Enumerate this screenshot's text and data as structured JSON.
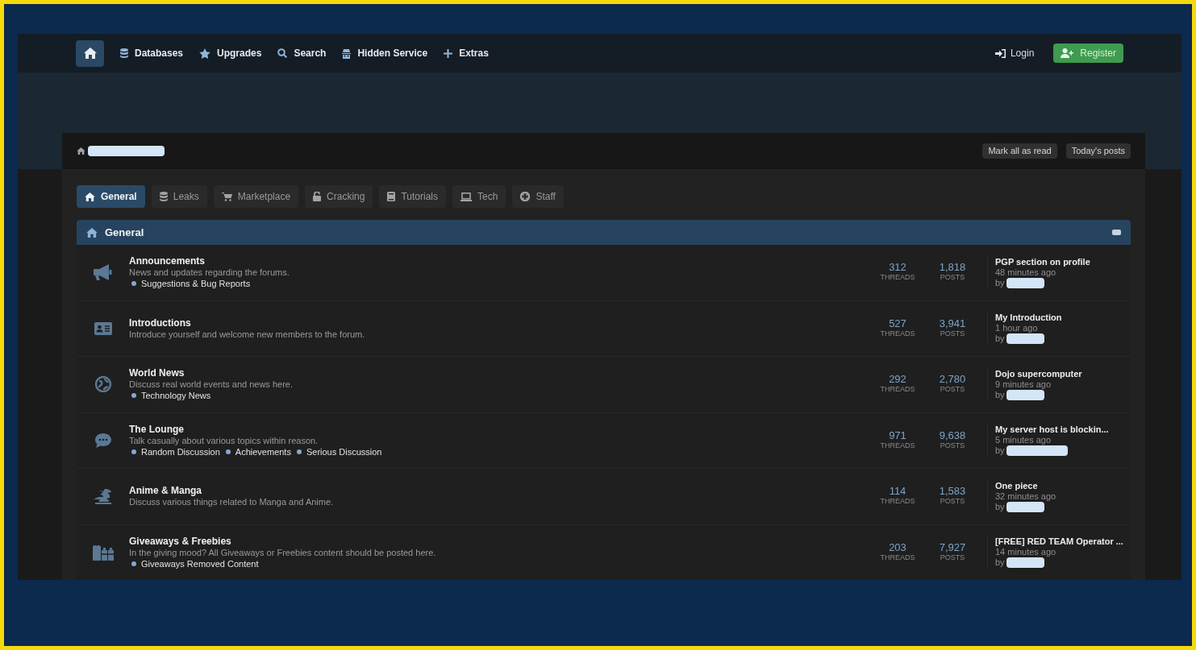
{
  "nav": {
    "items": [
      {
        "label": "Databases"
      },
      {
        "label": "Upgrades"
      },
      {
        "label": "Search"
      },
      {
        "label": "Hidden Service"
      },
      {
        "label": "Extras"
      }
    ],
    "login": "Login",
    "register": "Register"
  },
  "actions": [
    "Mark all as read",
    "Today's posts"
  ],
  "tabs": [
    {
      "label": "General",
      "selected": true
    },
    {
      "label": "Leaks",
      "selected": false
    },
    {
      "label": "Marketplace",
      "selected": false
    },
    {
      "label": "Cracking",
      "selected": false
    },
    {
      "label": "Tutorials",
      "selected": false
    },
    {
      "label": "Tech",
      "selected": false
    },
    {
      "label": "Staff",
      "selected": false
    }
  ],
  "section": {
    "title": "General"
  },
  "forums": [
    {
      "title": "Announcements",
      "description": "News and updates regarding the forums.",
      "subforums": [
        "Suggestions & Bug Reports"
      ],
      "threads": "312",
      "threads_label": "THREADS",
      "posts": "1,818",
      "posts_label": "POSTS",
      "last_post": {
        "title": "PGP section on profile",
        "time": "48 minutes ago",
        "by": "by"
      }
    },
    {
      "title": "Introductions",
      "description": "Introduce yourself and welcome new members to the forum.",
      "threads": "527",
      "threads_label": "THREADS",
      "posts": "3,941",
      "posts_label": "POSTS",
      "last_post": {
        "title": "My Introduction",
        "time": "1 hour ago",
        "by": "by"
      }
    },
    {
      "title": "World News",
      "description": "Discuss real world events and news here.",
      "subforums": [
        "Technology News"
      ],
      "threads": "292",
      "threads_label": "THREADS",
      "posts": "2,780",
      "posts_label": "POSTS",
      "last_post": {
        "title": "Dojo supercomputer",
        "time": "9 minutes ago",
        "by": "by"
      }
    },
    {
      "title": "The Lounge",
      "description": "Talk casually about various topics within reason.",
      "subforums": [
        "Random Discussion",
        "Achievements",
        "Serious Discussion"
      ],
      "threads": "971",
      "threads_label": "THREADS",
      "posts": "9,638",
      "posts_label": "POSTS",
      "last_post": {
        "title": "My server host is blockin...",
        "time": "5 minutes ago",
        "by": "by"
      }
    },
    {
      "title": "Anime & Manga",
      "description": "Discuss various things related to Manga and Anime.",
      "threads": "114",
      "threads_label": "THREADS",
      "posts": "1,583",
      "posts_label": "POSTS",
      "last_post": {
        "title": "One piece",
        "time": "32 minutes ago",
        "by": "by"
      }
    },
    {
      "title": "Giveaways & Freebies",
      "description": "In the giving mood? All Giveaways or Freebies content should be posted here.",
      "subforums": [
        "Giveaways Removed Content"
      ],
      "threads": "203",
      "threads_label": "THREADS",
      "posts": "7,927",
      "posts_label": "POSTS",
      "last_post": {
        "title": "[FREE] RED TEAM Operator ...",
        "time": "14 minutes ago",
        "by": "by"
      }
    }
  ]
}
